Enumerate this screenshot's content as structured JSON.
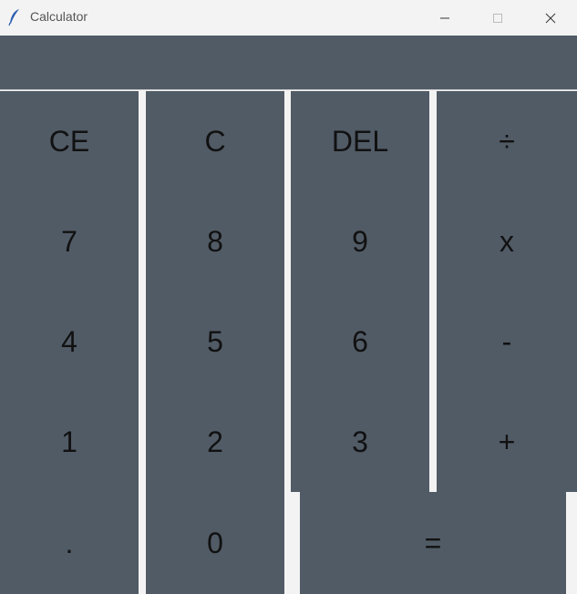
{
  "window": {
    "title": "Calculator"
  },
  "display": {
    "value": ""
  },
  "keys": {
    "ce": "CE",
    "c": "C",
    "del": "DEL",
    "divide": "÷",
    "seven": "7",
    "eight": "8",
    "nine": "9",
    "multiply": "x",
    "four": "4",
    "five": "5",
    "six": "6",
    "minus": "-",
    "one": "1",
    "two": "2",
    "three": "3",
    "plus": "+",
    "dot": ".",
    "zero": "0",
    "equals": "="
  },
  "colors": {
    "key_background": "#515b66",
    "window_background": "#f3f3f3",
    "key_text": "#111111"
  },
  "icons": {
    "app": "feather-icon",
    "minimize": "minimize-icon",
    "maximize": "maximize-icon",
    "close": "close-icon"
  }
}
